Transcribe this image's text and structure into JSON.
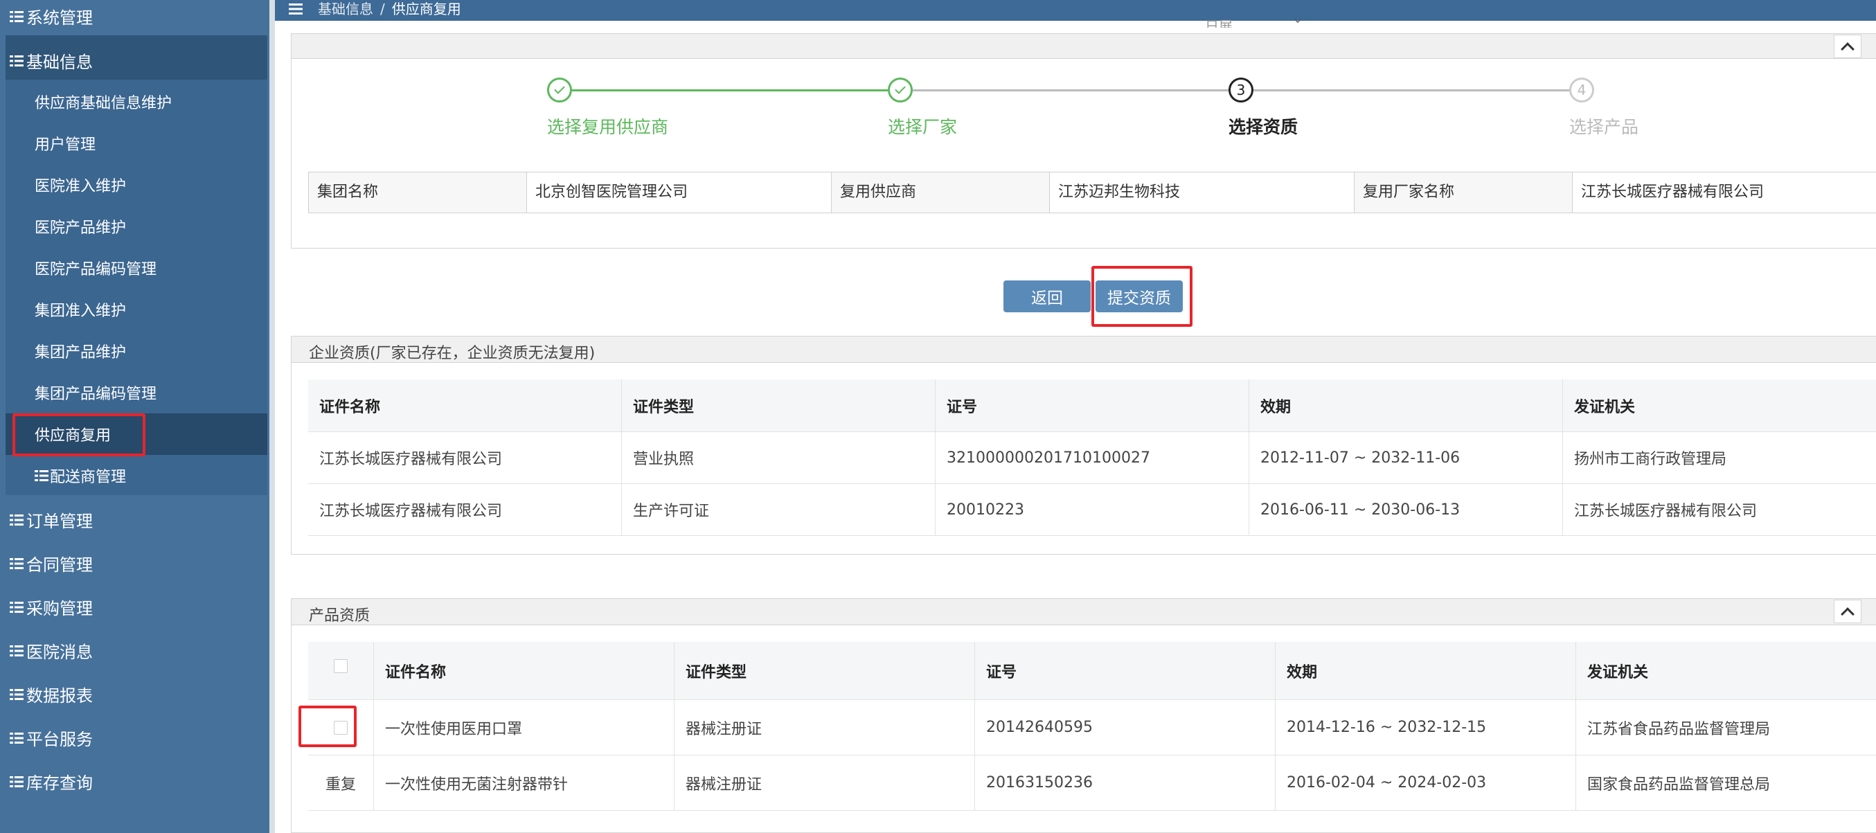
{
  "sidebar": {
    "top_items": [
      {
        "label": "系统管理"
      }
    ],
    "open_group": {
      "label": "基础信息",
      "items": [
        {
          "label": "供应商基础信息维护"
        },
        {
          "label": "用户管理"
        },
        {
          "label": "医院准入维护"
        },
        {
          "label": "医院产品维护"
        },
        {
          "label": "医院产品编码管理"
        },
        {
          "label": "集团准入维护"
        },
        {
          "label": "集团产品维护"
        },
        {
          "label": "集团产品编码管理"
        },
        {
          "label": "供应商复用"
        },
        {
          "label": "配送商管理"
        }
      ]
    },
    "bottom_items": [
      {
        "label": "订单管理"
      },
      {
        "label": "合同管理"
      },
      {
        "label": "采购管理"
      },
      {
        "label": "医院消息"
      },
      {
        "label": "数据报表"
      },
      {
        "label": "平台服务"
      },
      {
        "label": "库存查询"
      }
    ]
  },
  "topbar": {
    "breadcrumb": [
      "基础信息",
      "供应商复用"
    ],
    "ghost_text": "日展"
  },
  "steps": [
    {
      "label": "选择复用供应商",
      "state": "done",
      "number": ""
    },
    {
      "label": "选择厂家",
      "state": "done",
      "number": ""
    },
    {
      "label": "选择资质",
      "state": "current",
      "number": "3"
    },
    {
      "label": "选择产品",
      "state": "todo",
      "number": "4"
    }
  ],
  "colors": {
    "sidebar_bg": "#46719b",
    "topbar_bg": "#3d6a96",
    "done_green": "#5cb85c",
    "button_blue": "#5a8ab8",
    "highlight_red": "#e8252b"
  },
  "info": {
    "group_name_label": "集团名称",
    "group_name_value": "北京创智医院管理公司",
    "supplier_label": "复用供应商",
    "supplier_value": "江苏迈邦生物科技",
    "manufacturer_label": "复用厂家名称",
    "manufacturer_value": "江苏长城医疗器械有限公司"
  },
  "actions": {
    "back": "返回",
    "submit": "提交资质"
  },
  "enterprise": {
    "title": "企业资质(厂家已存在，企业资质无法复用)",
    "columns": [
      "证件名称",
      "证件类型",
      "证号",
      "效期",
      "发证机关"
    ],
    "rows": [
      [
        "江苏长城医疗器械有限公司",
        "营业执照",
        "321000000201710100027",
        "2012-11-07 ~ 2032-11-06",
        "扬州市工商行政管理局"
      ],
      [
        "江苏长城医疗器械有限公司",
        "生产许可证",
        "20010223",
        "2016-06-11 ~ 2030-06-13",
        "江苏长城医疗器械有限公司"
      ]
    ]
  },
  "product": {
    "title": "产品资质",
    "columns": [
      "证件名称",
      "证件类型",
      "证号",
      "效期",
      "发证机关"
    ],
    "rows": [
      {
        "first": "",
        "cells": [
          "一次性使用医用口罩",
          "器械注册证",
          "20142640595",
          "2014-12-16 ~ 2032-12-15",
          "江苏省食品药品监督管理局"
        ]
      },
      {
        "first": "重复",
        "cells": [
          "一次性使用无菌注射器带针",
          "器械注册证",
          "20163150236",
          "2016-02-04 ~ 2024-02-03",
          "国家食品药品监督管理总局"
        ]
      }
    ]
  }
}
